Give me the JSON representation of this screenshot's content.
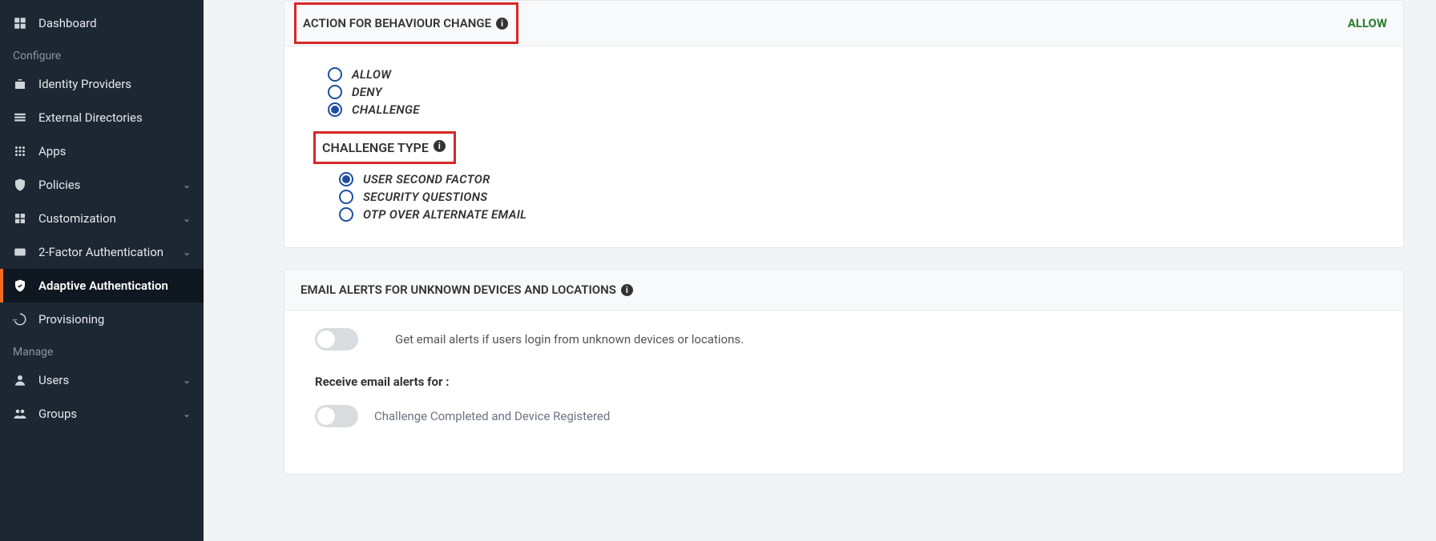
{
  "sidebar": {
    "items": [
      {
        "label": "Dashboard"
      }
    ],
    "section1_label": "Configure",
    "configure_items": [
      {
        "label": "Identity Providers",
        "chevron": false
      },
      {
        "label": "External Directories",
        "chevron": false
      },
      {
        "label": "Apps",
        "chevron": false
      },
      {
        "label": "Policies",
        "chevron": true
      },
      {
        "label": "Customization",
        "chevron": true
      },
      {
        "label": "2-Factor Authentication",
        "chevron": true
      },
      {
        "label": "Adaptive Authentication",
        "chevron": false,
        "active": true
      },
      {
        "label": "Provisioning",
        "chevron": false
      }
    ],
    "section2_label": "Manage",
    "manage_items": [
      {
        "label": "Users",
        "chevron": true
      },
      {
        "label": "Groups",
        "chevron": true
      }
    ]
  },
  "panel1": {
    "title": "ACTION FOR BEHAVIOUR CHANGE",
    "badge": "ALLOW",
    "options": [
      {
        "label": "ALLOW"
      },
      {
        "label": "DENY"
      },
      {
        "label": "CHALLENGE",
        "selected": true
      }
    ],
    "challenge_title": "CHALLENGE TYPE",
    "challenge_options": [
      {
        "label": "USER SECOND FACTOR",
        "selected": true
      },
      {
        "label": "SECURITY QUESTIONS"
      },
      {
        "label": "OTP OVER ALTERNATE EMAIL"
      }
    ]
  },
  "panel2": {
    "title": "EMAIL ALERTS FOR UNKNOWN DEVICES AND LOCATIONS",
    "toggle1_label": "Get email alerts if users login from unknown devices or locations.",
    "sub_heading": "Receive email alerts for :",
    "toggle2_label": "Challenge Completed and Device Registered"
  },
  "info_char": "i"
}
